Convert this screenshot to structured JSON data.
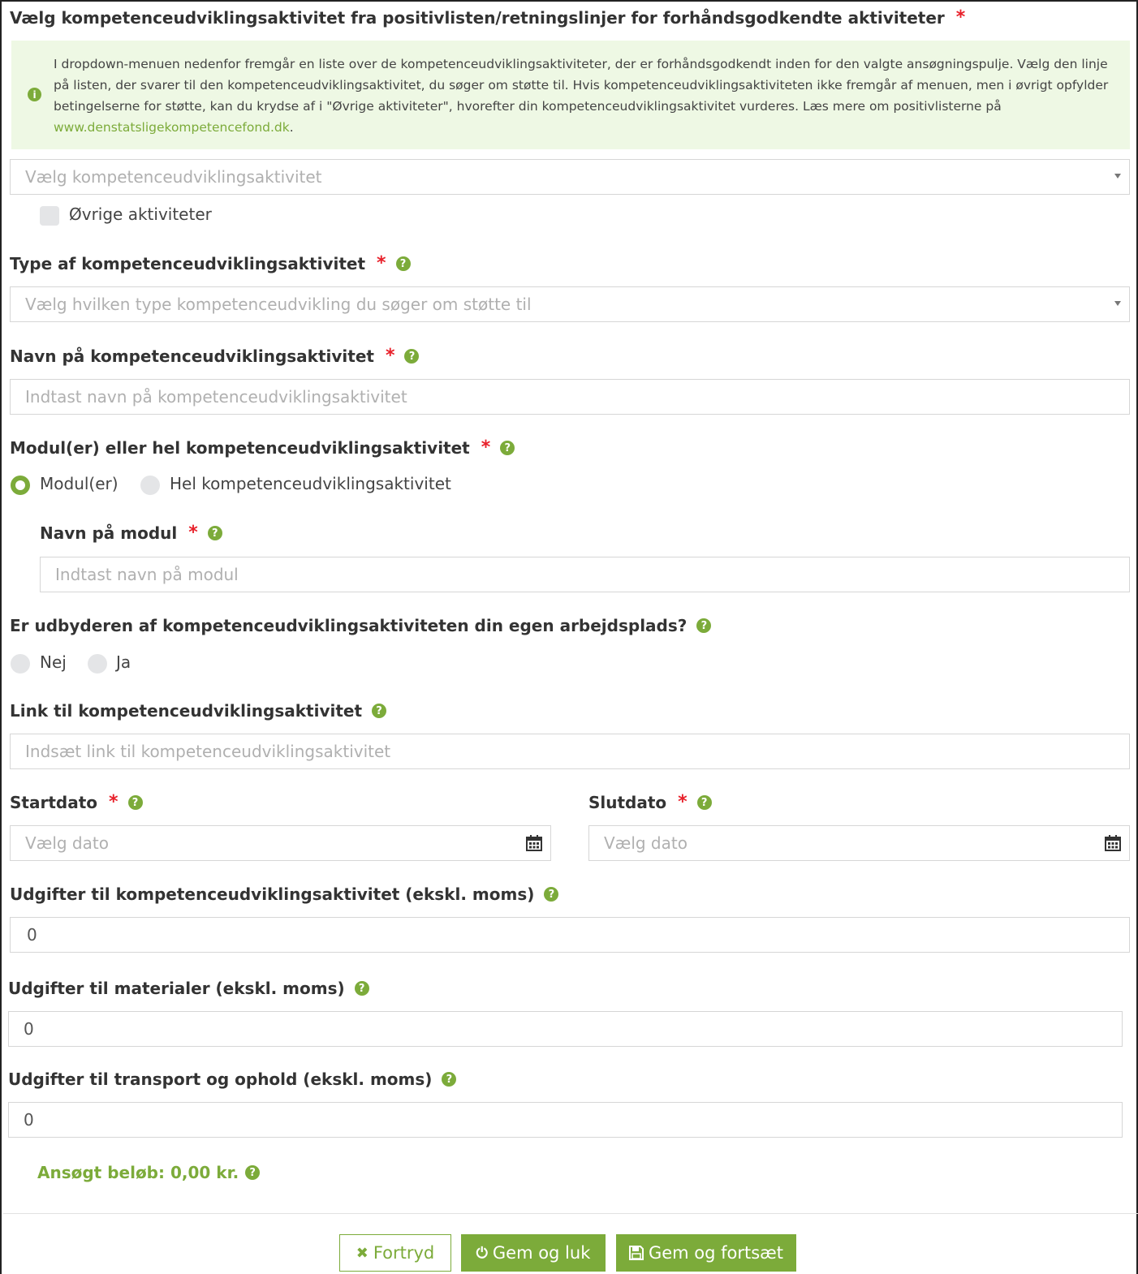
{
  "activity_select": {
    "label": "Vælg kompetenceudviklingsaktivitet fra positivlisten/retningslinjer for forhåndsgodkendte aktiviteter",
    "required_mark": "*",
    "info_text": "I dropdown-menuen nedenfor fremgår en liste over de kompetenceudviklingsaktiviteter, der er forhåndsgodkendt inden for den valgte ansøgningspulje. Vælg den linje på listen, der svarer til den kompetenceudviklingsaktivitet, du søger om støtte til. Hvis kompetenceudviklingsaktiviteten ikke fremgår af menuen, men i øvrigt opfylder betingelserne for støtte, kan du krydse af i \"Øvrige aktiviteter\", hvorefter din kompetenceudviklingsaktivitet vurderes. Læs mere om positivlisterne på ",
    "info_link": "www.denstatsligekompetencefond.dk",
    "info_suffix": ".",
    "placeholder": "Vælg kompetenceudviklingsaktivitet",
    "other_checkbox_label": "Øvrige aktiviteter",
    "other_checked": false
  },
  "type": {
    "label": "Type af kompetenceudviklingsaktivitet",
    "required_mark": "*",
    "placeholder": "Vælg hvilken type kompetenceudvikling du søger om støtte til"
  },
  "name": {
    "label": "Navn på kompetenceudviklingsaktivitet",
    "required_mark": "*",
    "placeholder": "Indtast navn på kompetenceudviklingsaktivitet"
  },
  "scope": {
    "label": "Modul(er) eller hel kompetenceudviklingsaktivitet",
    "required_mark": "*",
    "options": [
      "Modul(er)",
      "Hel kompetenceudviklingsaktivitet"
    ],
    "selected": "Modul(er)"
  },
  "module_name": {
    "label": "Navn på modul",
    "required_mark": "*",
    "placeholder": "Indtast navn på modul"
  },
  "provider": {
    "label": "Er udbyderen af kompetenceudviklingsaktiviteten din egen arbejdsplads?",
    "options": [
      "Nej",
      "Ja"
    ],
    "selected": null
  },
  "link": {
    "label": "Link til kompetenceudviklingsaktivitet",
    "placeholder": "Indsæt link til kompetenceudviklingsaktivitet"
  },
  "start_date": {
    "label": "Startdato",
    "required_mark": "*",
    "placeholder": "Vælg dato"
  },
  "end_date": {
    "label": "Slutdato",
    "required_mark": "*",
    "placeholder": "Vælg dato"
  },
  "cost_activity": {
    "label": "Udgifter til kompetenceudviklingsaktivitet (ekskl. moms)",
    "value": "0"
  },
  "cost_materials": {
    "label": "Udgifter til materialer (ekskl. moms)",
    "value": "0"
  },
  "cost_transport": {
    "label": "Udgifter til transport og ophold (ekskl. moms)",
    "value": "0"
  },
  "total": {
    "text": "Ansøgt beløb: 0,00 kr."
  },
  "buttons": {
    "cancel": "Fortryd",
    "save_close": "Gem og luk",
    "save_continue": "Gem og fortsæt"
  },
  "icons": {
    "help": "question-circle-icon",
    "info": "info-circle-icon",
    "calendar": "calendar-icon",
    "cancel": "times-icon",
    "save_close": "power-icon",
    "save_continue": "floppy-disk-icon"
  },
  "colors": {
    "accent": "#7cab3a",
    "required": "#e8202a",
    "info_bg": "#eef8e4"
  }
}
